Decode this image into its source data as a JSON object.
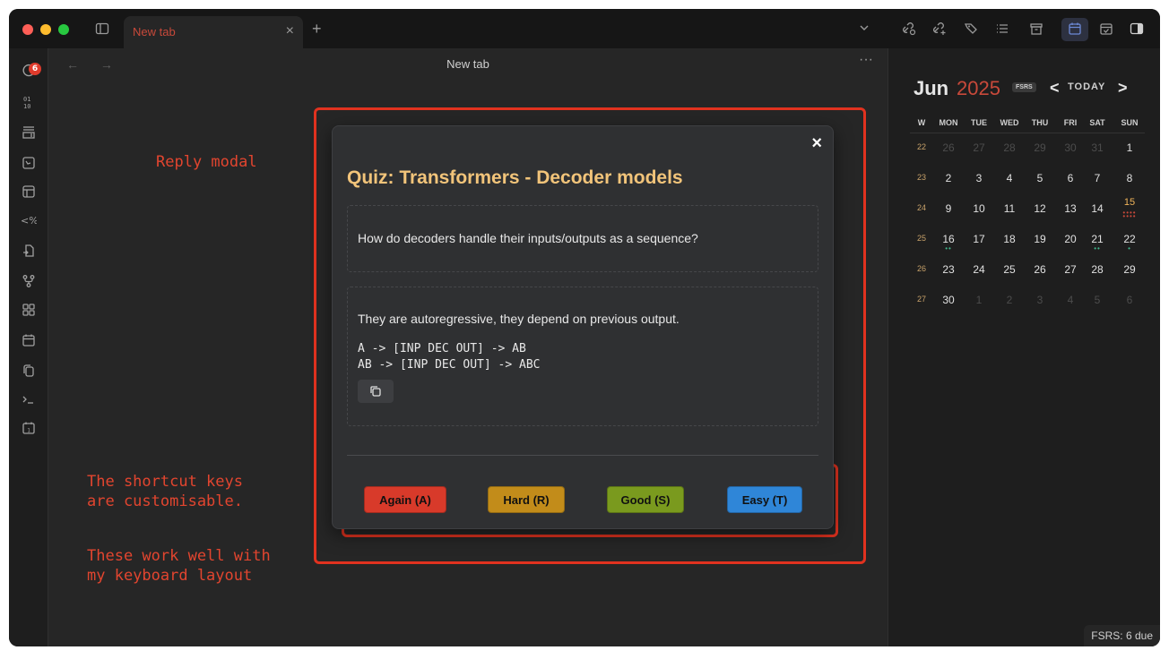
{
  "titlebar": {
    "tab_label": "New tab",
    "tab_close": "×",
    "new_tab": "+"
  },
  "ribbon": {
    "badge_count": "6"
  },
  "main": {
    "title": "New tab",
    "nav_arrows": "← →",
    "more": "···"
  },
  "annotations": {
    "reply_modal": "Reply modal",
    "shortcut_note": "The shortcut keys\nare customisable.",
    "layout_note": "These work well with\nmy keyboard layout",
    "color": "#e1321f"
  },
  "modal": {
    "close": "×",
    "title": "Quiz: Transformers - Decoder models",
    "question": "How do decoders handle their inputs/outputs as a sequence?",
    "answer": "They are autoregressive, they depend on previous output.",
    "code": "A -> [INP DEC OUT] -> AB\nAB -> [INP DEC OUT] -> ABC",
    "buttons": {
      "again": "Again (A)",
      "hard": "Hard (R)",
      "good": "Good (S)",
      "easy": "Easy (T)"
    }
  },
  "calendar": {
    "month": "Jun",
    "year": "2025",
    "fsrs_tag": "FSRS",
    "prev": "<",
    "today": "TODAY",
    "next": ">",
    "headers": [
      "W",
      "MON",
      "TUE",
      "WED",
      "THU",
      "FRI",
      "SAT",
      "SUN"
    ],
    "weeks": [
      {
        "week": "22",
        "days": [
          "26",
          "27",
          "28",
          "29",
          "30",
          "31",
          "1"
        ],
        "dim": [
          true,
          true,
          true,
          true,
          true,
          true,
          false
        ]
      },
      {
        "week": "23",
        "days": [
          "2",
          "3",
          "4",
          "5",
          "6",
          "7",
          "8"
        ],
        "dim": [
          false,
          false,
          false,
          false,
          false,
          false,
          false
        ]
      },
      {
        "week": "24",
        "days": [
          "9",
          "10",
          "11",
          "12",
          "13",
          "14",
          "15"
        ],
        "dim": [
          false,
          false,
          false,
          false,
          false,
          false,
          false
        ]
      },
      {
        "week": "25",
        "days": [
          "16",
          "17",
          "18",
          "19",
          "20",
          "21",
          "22"
        ],
        "dim": [
          false,
          false,
          false,
          false,
          false,
          false,
          false
        ]
      },
      {
        "week": "26",
        "days": [
          "23",
          "24",
          "25",
          "26",
          "27",
          "28",
          "29"
        ],
        "dim": [
          false,
          false,
          false,
          false,
          false,
          false,
          false
        ]
      },
      {
        "week": "27",
        "days": [
          "30",
          "1",
          "2",
          "3",
          "4",
          "5",
          "6"
        ],
        "dim": [
          false,
          true,
          true,
          true,
          true,
          true,
          true
        ]
      }
    ],
    "today_date": "15"
  },
  "status_bar": {
    "text": "FSRS: 6 due"
  }
}
